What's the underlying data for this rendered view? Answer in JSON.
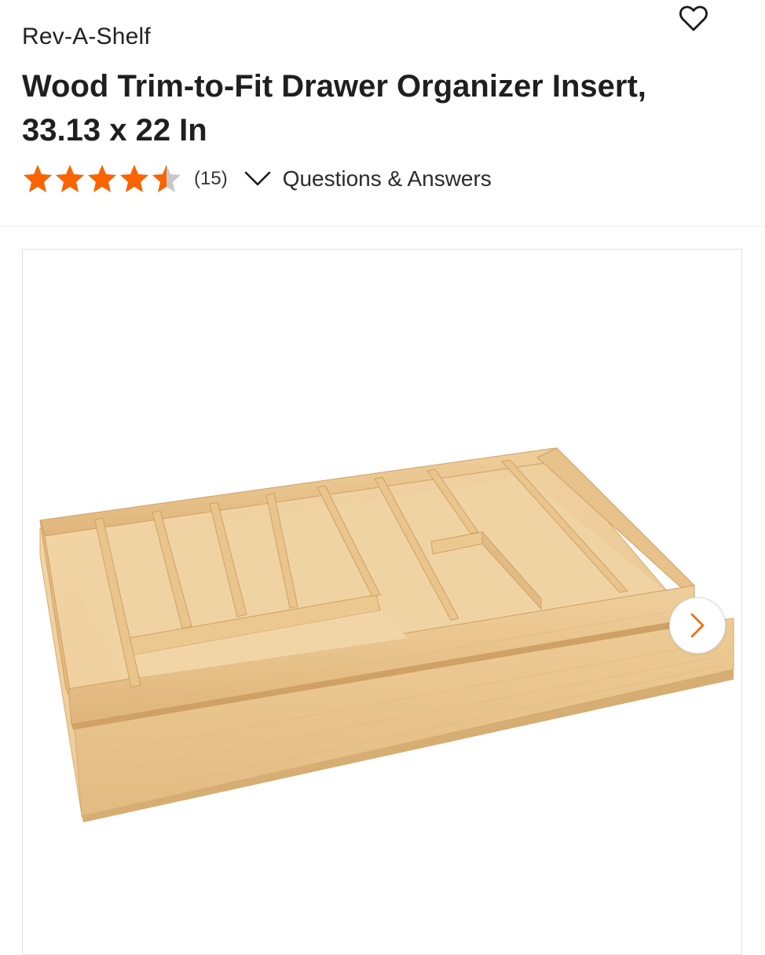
{
  "product": {
    "brand": "Rev-A-Shelf",
    "title": "Wood Trim-to-Fit Drawer Organizer Insert, 33.13 x 22 In",
    "rating": 4.5,
    "review_count": "(15)",
    "qa_label": "Questions & Answers"
  },
  "icons": {
    "favorite": "heart-outline-icon",
    "expand": "chevron-down-icon",
    "next": "chevron-right-icon",
    "rating": "star-icon"
  },
  "colors": {
    "star_filled": "#f96302",
    "star_empty": "#c8c8c8",
    "next_chevron": "#f96302",
    "text_primary": "#1f1f1f"
  }
}
